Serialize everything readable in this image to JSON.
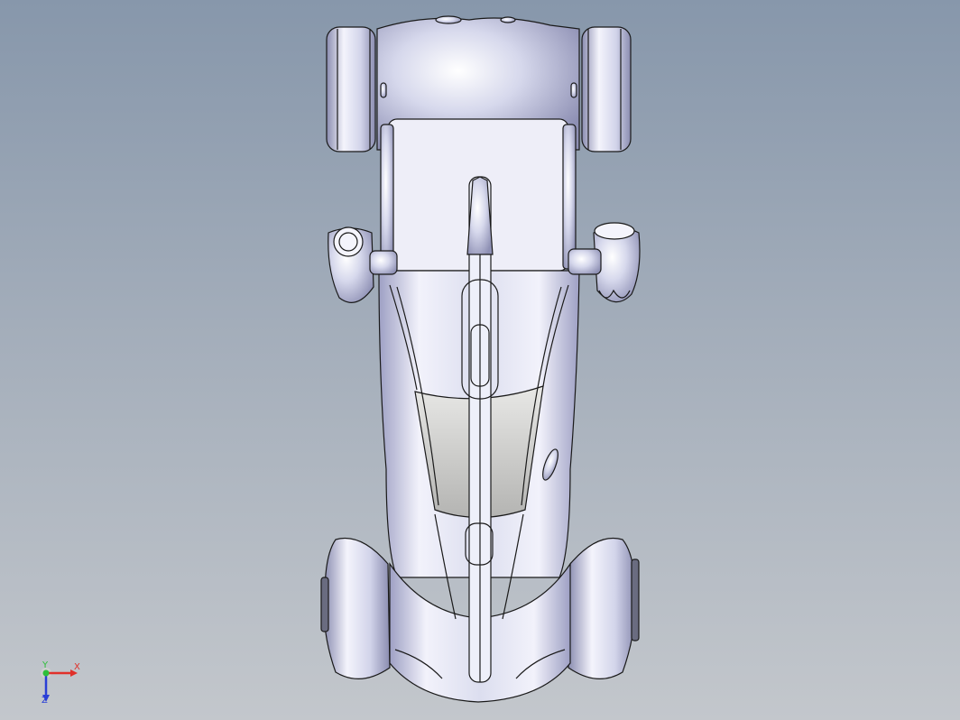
{
  "viewport": {
    "background_top": "#8797ab",
    "background_bottom": "#c3c7cc",
    "model_color": "#c6c8e0",
    "glass_color": "#c8c8c8"
  },
  "triad": {
    "x_label": "X",
    "y_label": "Y",
    "z_label": "Z",
    "x_color": "#e0302a",
    "y_color": "#2fbf3a",
    "z_color": "#2a3fd6"
  }
}
